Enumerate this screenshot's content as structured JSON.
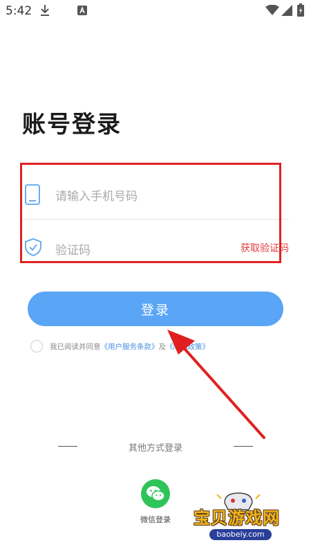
{
  "status_bar": {
    "time": "5:42"
  },
  "page": {
    "title": "账号登录"
  },
  "form": {
    "phone_placeholder": "请输入手机号码",
    "code_placeholder": "验证码",
    "get_code_label": "获取验证码"
  },
  "login_button": {
    "label": "登录"
  },
  "agreement": {
    "prefix": "我已阅读并同意",
    "terms_link": "《用户服务条款》",
    "and": "及",
    "privacy_link": "《隐私政策》"
  },
  "other_login": {
    "label": "其他方式登录",
    "wechat_label": "微信登录"
  },
  "watermark": {
    "title": "宝贝游戏网",
    "url": "baobeiy.com"
  },
  "colors": {
    "accent_blue": "#5aa5f5",
    "link_blue": "#4a90e2",
    "error_red": "#e83a3a",
    "annotation_red": "#e02020",
    "wechat_green": "#2fc45a"
  },
  "icons": [
    "download-icon",
    "app-notification-icon",
    "wifi-icon",
    "signal-icon",
    "battery-icon",
    "phone-icon",
    "shield-check-icon",
    "wechat-icon"
  ]
}
